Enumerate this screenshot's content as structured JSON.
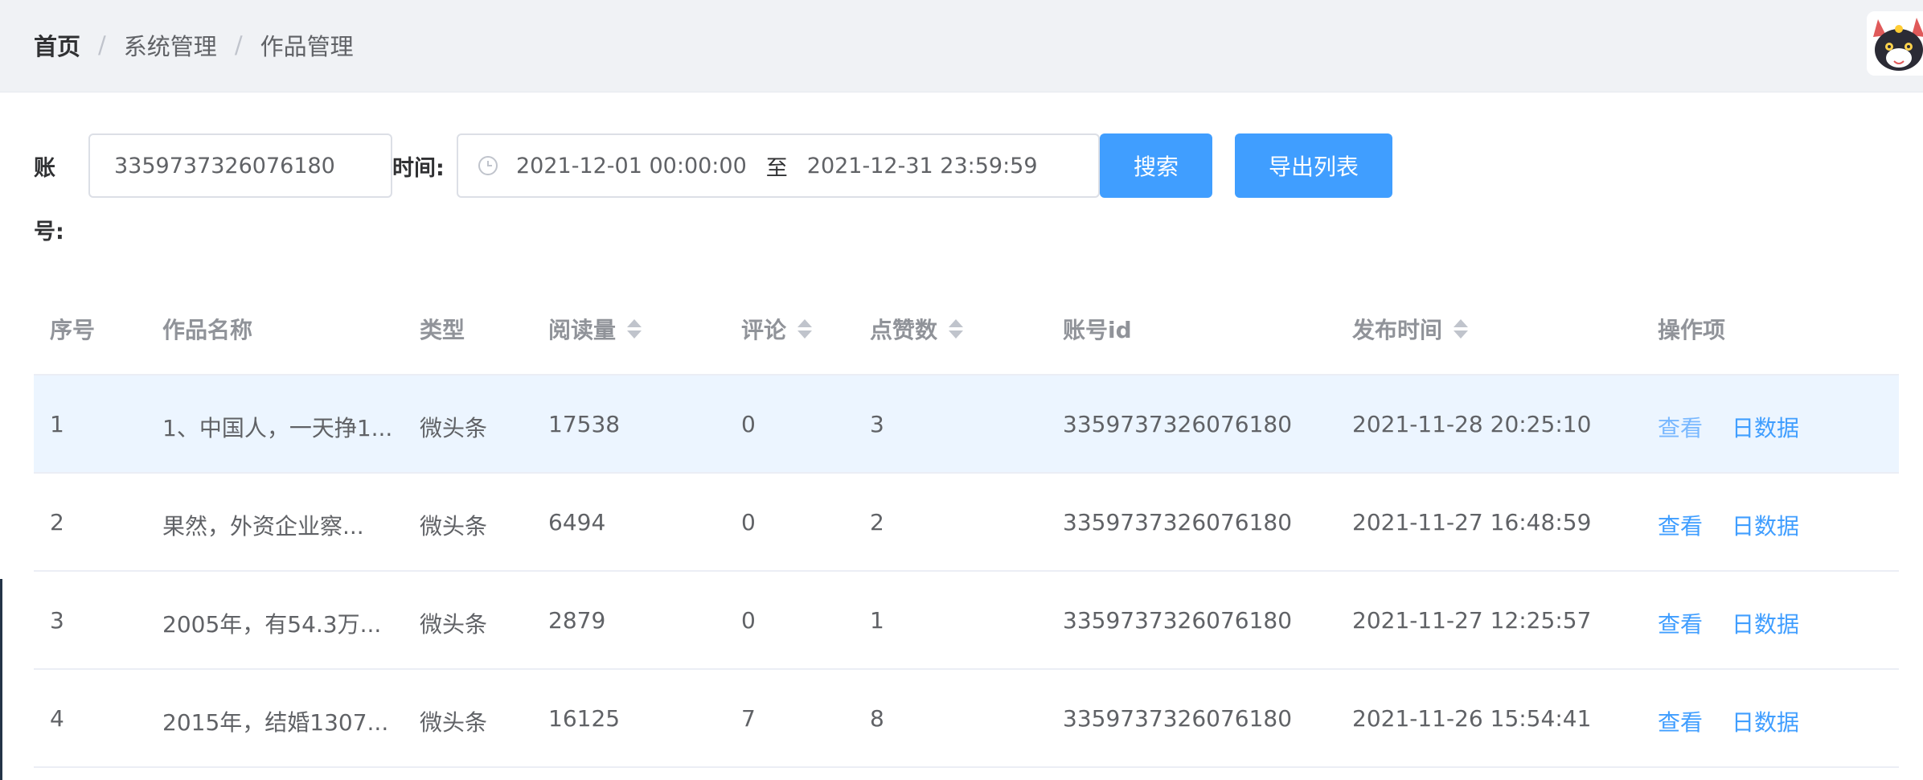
{
  "breadcrumb": [
    "首页",
    "系统管理",
    "作品管理"
  ],
  "search": {
    "account_label_1": "账",
    "account_label_2": "号:",
    "account_value": "3359737326076180",
    "time_label": "时间:",
    "start_time": "2021-12-01 00:00:00",
    "range_separator": "至",
    "end_time": "2021-12-31 23:59:59",
    "search_button": "搜索",
    "export_button": "导出列表"
  },
  "table": {
    "headers": {
      "index": "序号",
      "name": "作品名称",
      "type": "类型",
      "reads": "阅读量",
      "comments": "评论",
      "likes": "点赞数",
      "account_id": "账号id",
      "publish_time": "发布时间",
      "actions": "操作项"
    },
    "rows": [
      {
        "index": "1",
        "name": "1、中国人，一天挣1...",
        "type": "微头条",
        "reads": "17538",
        "comments": "0",
        "likes": "3",
        "account_id": "3359737326076180",
        "publish_time": "2021-11-28 20:25:10",
        "view": "查看",
        "daily": "日数据"
      },
      {
        "index": "2",
        "name": "果然，外资企业察...",
        "type": "微头条",
        "reads": "6494",
        "comments": "0",
        "likes": "2",
        "account_id": "3359737326076180",
        "publish_time": "2021-11-27 16:48:59",
        "view": "查看",
        "daily": "日数据"
      },
      {
        "index": "3",
        "name": "2005年，有54.3万...",
        "type": "微头条",
        "reads": "2879",
        "comments": "0",
        "likes": "1",
        "account_id": "3359737326076180",
        "publish_time": "2021-11-27 12:25:57",
        "view": "查看",
        "daily": "日数据"
      },
      {
        "index": "4",
        "name": "2015年，结婚1307...",
        "type": "微头条",
        "reads": "16125",
        "comments": "7",
        "likes": "8",
        "account_id": "3359737326076180",
        "publish_time": "2021-11-26 15:54:41",
        "view": "查看",
        "daily": "日数据"
      }
    ]
  },
  "colors": {
    "primary": "#409eff",
    "header_bg": "#f0f2f5",
    "row_highlight": "#ecf5ff"
  },
  "icons": {
    "clock": "clock-icon",
    "sort": "sort-caret-icon",
    "avatar": "cat-avatar"
  }
}
